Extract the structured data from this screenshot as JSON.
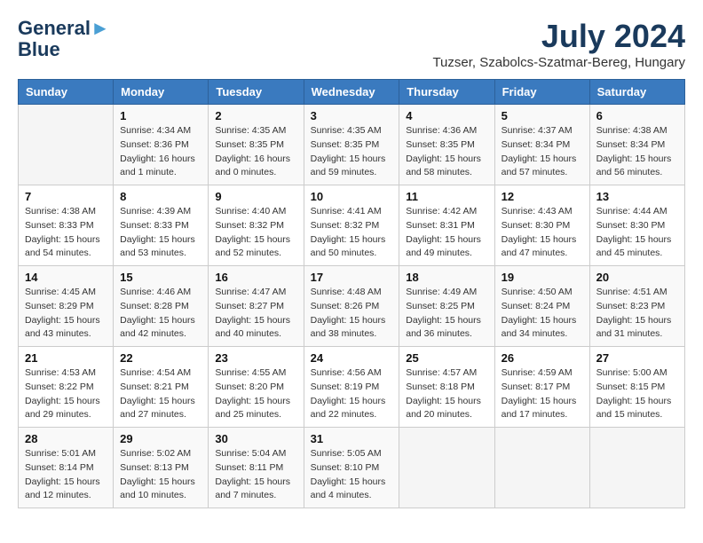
{
  "logo": {
    "line1": "General",
    "line2": "Blue"
  },
  "title": "July 2024",
  "location": "Tuzser, Szabolcs-Szatmar-Bereg, Hungary",
  "days_of_week": [
    "Sunday",
    "Monday",
    "Tuesday",
    "Wednesday",
    "Thursday",
    "Friday",
    "Saturday"
  ],
  "weeks": [
    [
      {
        "day": "",
        "sunrise": "",
        "sunset": "",
        "daylight": ""
      },
      {
        "day": "1",
        "sunrise": "Sunrise: 4:34 AM",
        "sunset": "Sunset: 8:36 PM",
        "daylight": "Daylight: 16 hours and 1 minute."
      },
      {
        "day": "2",
        "sunrise": "Sunrise: 4:35 AM",
        "sunset": "Sunset: 8:35 PM",
        "daylight": "Daylight: 16 hours and 0 minutes."
      },
      {
        "day": "3",
        "sunrise": "Sunrise: 4:35 AM",
        "sunset": "Sunset: 8:35 PM",
        "daylight": "Daylight: 15 hours and 59 minutes."
      },
      {
        "day": "4",
        "sunrise": "Sunrise: 4:36 AM",
        "sunset": "Sunset: 8:35 PM",
        "daylight": "Daylight: 15 hours and 58 minutes."
      },
      {
        "day": "5",
        "sunrise": "Sunrise: 4:37 AM",
        "sunset": "Sunset: 8:34 PM",
        "daylight": "Daylight: 15 hours and 57 minutes."
      },
      {
        "day": "6",
        "sunrise": "Sunrise: 4:38 AM",
        "sunset": "Sunset: 8:34 PM",
        "daylight": "Daylight: 15 hours and 56 minutes."
      }
    ],
    [
      {
        "day": "7",
        "sunrise": "Sunrise: 4:38 AM",
        "sunset": "Sunset: 8:33 PM",
        "daylight": "Daylight: 15 hours and 54 minutes."
      },
      {
        "day": "8",
        "sunrise": "Sunrise: 4:39 AM",
        "sunset": "Sunset: 8:33 PM",
        "daylight": "Daylight: 15 hours and 53 minutes."
      },
      {
        "day": "9",
        "sunrise": "Sunrise: 4:40 AM",
        "sunset": "Sunset: 8:32 PM",
        "daylight": "Daylight: 15 hours and 52 minutes."
      },
      {
        "day": "10",
        "sunrise": "Sunrise: 4:41 AM",
        "sunset": "Sunset: 8:32 PM",
        "daylight": "Daylight: 15 hours and 50 minutes."
      },
      {
        "day": "11",
        "sunrise": "Sunrise: 4:42 AM",
        "sunset": "Sunset: 8:31 PM",
        "daylight": "Daylight: 15 hours and 49 minutes."
      },
      {
        "day": "12",
        "sunrise": "Sunrise: 4:43 AM",
        "sunset": "Sunset: 8:30 PM",
        "daylight": "Daylight: 15 hours and 47 minutes."
      },
      {
        "day": "13",
        "sunrise": "Sunrise: 4:44 AM",
        "sunset": "Sunset: 8:30 PM",
        "daylight": "Daylight: 15 hours and 45 minutes."
      }
    ],
    [
      {
        "day": "14",
        "sunrise": "Sunrise: 4:45 AM",
        "sunset": "Sunset: 8:29 PM",
        "daylight": "Daylight: 15 hours and 43 minutes."
      },
      {
        "day": "15",
        "sunrise": "Sunrise: 4:46 AM",
        "sunset": "Sunset: 8:28 PM",
        "daylight": "Daylight: 15 hours and 42 minutes."
      },
      {
        "day": "16",
        "sunrise": "Sunrise: 4:47 AM",
        "sunset": "Sunset: 8:27 PM",
        "daylight": "Daylight: 15 hours and 40 minutes."
      },
      {
        "day": "17",
        "sunrise": "Sunrise: 4:48 AM",
        "sunset": "Sunset: 8:26 PM",
        "daylight": "Daylight: 15 hours and 38 minutes."
      },
      {
        "day": "18",
        "sunrise": "Sunrise: 4:49 AM",
        "sunset": "Sunset: 8:25 PM",
        "daylight": "Daylight: 15 hours and 36 minutes."
      },
      {
        "day": "19",
        "sunrise": "Sunrise: 4:50 AM",
        "sunset": "Sunset: 8:24 PM",
        "daylight": "Daylight: 15 hours and 34 minutes."
      },
      {
        "day": "20",
        "sunrise": "Sunrise: 4:51 AM",
        "sunset": "Sunset: 8:23 PM",
        "daylight": "Daylight: 15 hours and 31 minutes."
      }
    ],
    [
      {
        "day": "21",
        "sunrise": "Sunrise: 4:53 AM",
        "sunset": "Sunset: 8:22 PM",
        "daylight": "Daylight: 15 hours and 29 minutes."
      },
      {
        "day": "22",
        "sunrise": "Sunrise: 4:54 AM",
        "sunset": "Sunset: 8:21 PM",
        "daylight": "Daylight: 15 hours and 27 minutes."
      },
      {
        "day": "23",
        "sunrise": "Sunrise: 4:55 AM",
        "sunset": "Sunset: 8:20 PM",
        "daylight": "Daylight: 15 hours and 25 minutes."
      },
      {
        "day": "24",
        "sunrise": "Sunrise: 4:56 AM",
        "sunset": "Sunset: 8:19 PM",
        "daylight": "Daylight: 15 hours and 22 minutes."
      },
      {
        "day": "25",
        "sunrise": "Sunrise: 4:57 AM",
        "sunset": "Sunset: 8:18 PM",
        "daylight": "Daylight: 15 hours and 20 minutes."
      },
      {
        "day": "26",
        "sunrise": "Sunrise: 4:59 AM",
        "sunset": "Sunset: 8:17 PM",
        "daylight": "Daylight: 15 hours and 17 minutes."
      },
      {
        "day": "27",
        "sunrise": "Sunrise: 5:00 AM",
        "sunset": "Sunset: 8:15 PM",
        "daylight": "Daylight: 15 hours and 15 minutes."
      }
    ],
    [
      {
        "day": "28",
        "sunrise": "Sunrise: 5:01 AM",
        "sunset": "Sunset: 8:14 PM",
        "daylight": "Daylight: 15 hours and 12 minutes."
      },
      {
        "day": "29",
        "sunrise": "Sunrise: 5:02 AM",
        "sunset": "Sunset: 8:13 PM",
        "daylight": "Daylight: 15 hours and 10 minutes."
      },
      {
        "day": "30",
        "sunrise": "Sunrise: 5:04 AM",
        "sunset": "Sunset: 8:11 PM",
        "daylight": "Daylight: 15 hours and 7 minutes."
      },
      {
        "day": "31",
        "sunrise": "Sunrise: 5:05 AM",
        "sunset": "Sunset: 8:10 PM",
        "daylight": "Daylight: 15 hours and 4 minutes."
      },
      {
        "day": "",
        "sunrise": "",
        "sunset": "",
        "daylight": ""
      },
      {
        "day": "",
        "sunrise": "",
        "sunset": "",
        "daylight": ""
      },
      {
        "day": "",
        "sunrise": "",
        "sunset": "",
        "daylight": ""
      }
    ]
  ]
}
